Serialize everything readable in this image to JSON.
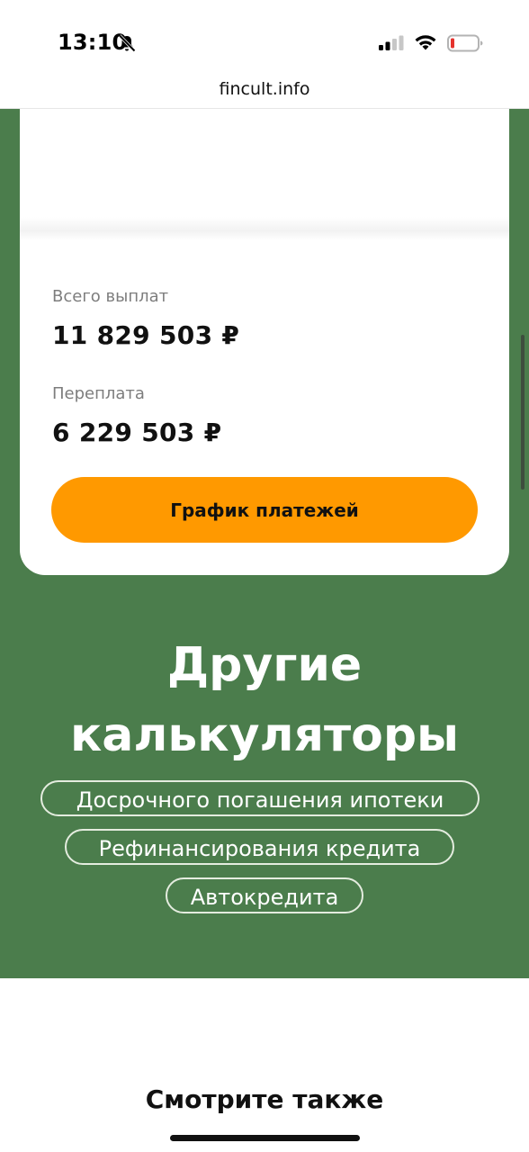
{
  "status_bar": {
    "time": "13:10",
    "icons": [
      "bell-slash-icon",
      "signal-icon",
      "wifi-icon",
      "battery-low-icon"
    ],
    "battery_color": "#e5322d"
  },
  "browser": {
    "url": "fincult.info"
  },
  "summary": {
    "total_label": "Всего выплат",
    "total_value": "11 829 503 ₽",
    "overpay_label": "Переплата",
    "overpay_value": "6 229 503 ₽",
    "schedule_button": "График платежей"
  },
  "other_calculators": {
    "title_line1": "Другие",
    "title_line2": "калькуляторы",
    "links": [
      "Досрочного погашения ипотеки",
      "Рефинансирования кредита",
      "Автокредита"
    ]
  },
  "see_also": "Смотрите также",
  "colors": {
    "green_background": "#4b7d4c",
    "button_orange": "#ff9900",
    "text_dark": "#111111",
    "label_gray": "#7d7d7d"
  }
}
